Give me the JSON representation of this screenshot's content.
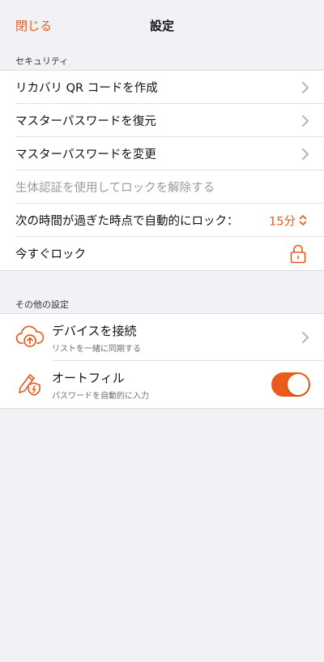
{
  "nav": {
    "close_label": "閉じる",
    "title": "設定"
  },
  "security": {
    "header": "セキュリティ",
    "rows": [
      {
        "label": "リカバリ QR コードを作成"
      },
      {
        "label": "マスターパスワードを復元"
      },
      {
        "label": "マスターパスワードを変更"
      },
      {
        "label": "生体認証を使用してロックを解除する",
        "disabled": true
      },
      {
        "label": "次の時間が過ぎた時点で自動的にロック：",
        "value": "15分"
      },
      {
        "label": "今すぐロック"
      }
    ]
  },
  "other": {
    "header": "その他の設定",
    "rows": [
      {
        "title": "デバイスを接続",
        "subtitle": "リストを一緒に同期する"
      },
      {
        "title": "オートフィル",
        "subtitle": "パスワードを自動的に入力",
        "toggle_on": true
      }
    ]
  },
  "colors": {
    "accent": "#ea5a1b",
    "background": "#f1f1f6",
    "disabled_text": "#9a9a9e"
  },
  "icons": {
    "chevron": "chevron-right-icon",
    "updown": "chevron-updown-icon",
    "lock": "lock-icon",
    "cloud_sync": "cloud-sync-icon",
    "autofill": "pencil-shield-icon"
  }
}
